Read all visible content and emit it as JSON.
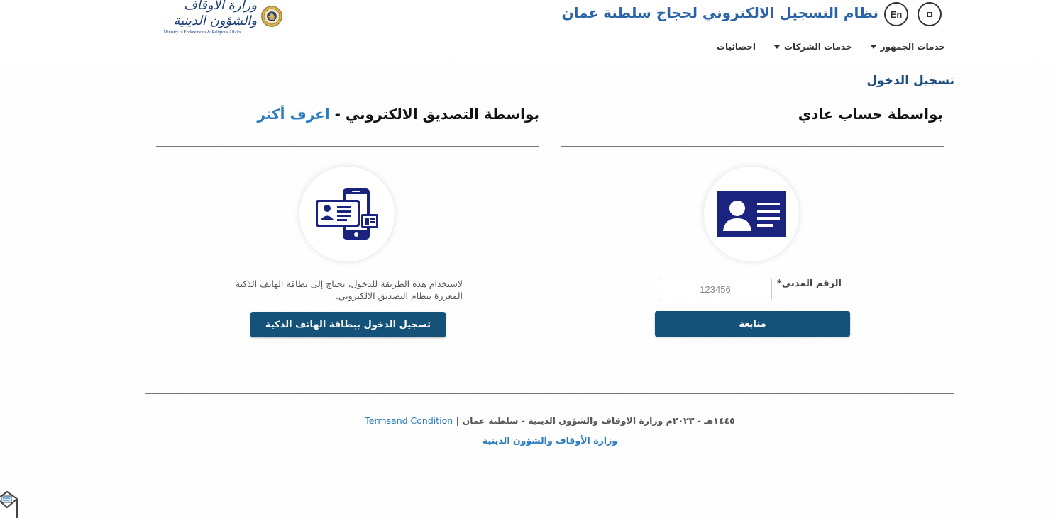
{
  "header": {
    "logo_arabic": "وزارة الأوقاف والشؤون الدينية",
    "logo_english": "Ministry of Endowments & Religious Affairs",
    "title": "نظام التسجيل الالكتروني لحجاج سلطنة عمان",
    "lang_button": "En",
    "accessibility_icon": "accessibility-icon"
  },
  "nav": {
    "items": [
      {
        "label": "خدمات الجمهور",
        "dropdown": true
      },
      {
        "label": "خدمات الشركات",
        "dropdown": true
      },
      {
        "label": "احصائيات",
        "dropdown": false
      }
    ]
  },
  "page": {
    "section_title": "تسجيل الدخول"
  },
  "regular_login": {
    "heading": "بواسطة حساب عادي",
    "icon": "id-card-icon",
    "field_label": "الرقم المدني",
    "required_mark": "*",
    "field_placeholder": "123456",
    "button_label": "متابعة"
  },
  "pki_login": {
    "heading": "بواسطة التصديق الالكتروني - ",
    "learn_more": "اعرف أكثر",
    "icon": "smart-card-phone-icon",
    "description": "لاستخدام هذه الطريقة للدخول، تحتاج إلى بطاقة الهاتف الذكية المعززة بنظام التصديق الالكتروني.",
    "button_label": "تسجيل الدخول ببطاقة الهاتف الذكية"
  },
  "footer": {
    "terms": "Termsand Condition",
    "separator": " | ",
    "copyright": "١٤٤٥هـ - ٢٠٢٣م وزارة الاوقاف والشؤون الدينية - سلطنة عمان",
    "ministry_link": "وزارة الأوقاف والشؤون الدينية"
  },
  "colors": {
    "primary_button": "#14527a",
    "title_blue": "#2b63a8",
    "link_blue": "#2b7bc0",
    "icon_navy": "#1a237e"
  }
}
